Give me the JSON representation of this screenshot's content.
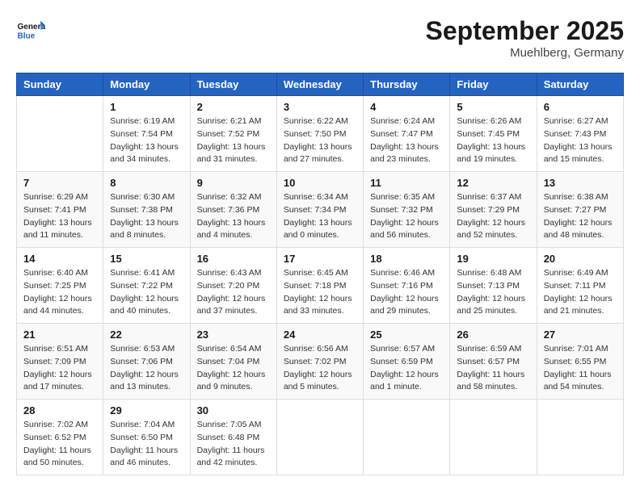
{
  "header": {
    "logo_text_general": "General",
    "logo_text_blue": "Blue",
    "month_title": "September 2025",
    "location": "Muehlberg, Germany"
  },
  "days_of_week": [
    "Sunday",
    "Monday",
    "Tuesday",
    "Wednesday",
    "Thursday",
    "Friday",
    "Saturday"
  ],
  "weeks": [
    [
      {
        "day": "",
        "sunrise": "",
        "sunset": "",
        "daylight": ""
      },
      {
        "day": "1",
        "sunrise": "Sunrise: 6:19 AM",
        "sunset": "Sunset: 7:54 PM",
        "daylight": "Daylight: 13 hours and 34 minutes."
      },
      {
        "day": "2",
        "sunrise": "Sunrise: 6:21 AM",
        "sunset": "Sunset: 7:52 PM",
        "daylight": "Daylight: 13 hours and 31 minutes."
      },
      {
        "day": "3",
        "sunrise": "Sunrise: 6:22 AM",
        "sunset": "Sunset: 7:50 PM",
        "daylight": "Daylight: 13 hours and 27 minutes."
      },
      {
        "day": "4",
        "sunrise": "Sunrise: 6:24 AM",
        "sunset": "Sunset: 7:47 PM",
        "daylight": "Daylight: 13 hours and 23 minutes."
      },
      {
        "day": "5",
        "sunrise": "Sunrise: 6:26 AM",
        "sunset": "Sunset: 7:45 PM",
        "daylight": "Daylight: 13 hours and 19 minutes."
      },
      {
        "day": "6",
        "sunrise": "Sunrise: 6:27 AM",
        "sunset": "Sunset: 7:43 PM",
        "daylight": "Daylight: 13 hours and 15 minutes."
      }
    ],
    [
      {
        "day": "7",
        "sunrise": "Sunrise: 6:29 AM",
        "sunset": "Sunset: 7:41 PM",
        "daylight": "Daylight: 13 hours and 11 minutes."
      },
      {
        "day": "8",
        "sunrise": "Sunrise: 6:30 AM",
        "sunset": "Sunset: 7:38 PM",
        "daylight": "Daylight: 13 hours and 8 minutes."
      },
      {
        "day": "9",
        "sunrise": "Sunrise: 6:32 AM",
        "sunset": "Sunset: 7:36 PM",
        "daylight": "Daylight: 13 hours and 4 minutes."
      },
      {
        "day": "10",
        "sunrise": "Sunrise: 6:34 AM",
        "sunset": "Sunset: 7:34 PM",
        "daylight": "Daylight: 13 hours and 0 minutes."
      },
      {
        "day": "11",
        "sunrise": "Sunrise: 6:35 AM",
        "sunset": "Sunset: 7:32 PM",
        "daylight": "Daylight: 12 hours and 56 minutes."
      },
      {
        "day": "12",
        "sunrise": "Sunrise: 6:37 AM",
        "sunset": "Sunset: 7:29 PM",
        "daylight": "Daylight: 12 hours and 52 minutes."
      },
      {
        "day": "13",
        "sunrise": "Sunrise: 6:38 AM",
        "sunset": "Sunset: 7:27 PM",
        "daylight": "Daylight: 12 hours and 48 minutes."
      }
    ],
    [
      {
        "day": "14",
        "sunrise": "Sunrise: 6:40 AM",
        "sunset": "Sunset: 7:25 PM",
        "daylight": "Daylight: 12 hours and 44 minutes."
      },
      {
        "day": "15",
        "sunrise": "Sunrise: 6:41 AM",
        "sunset": "Sunset: 7:22 PM",
        "daylight": "Daylight: 12 hours and 40 minutes."
      },
      {
        "day": "16",
        "sunrise": "Sunrise: 6:43 AM",
        "sunset": "Sunset: 7:20 PM",
        "daylight": "Daylight: 12 hours and 37 minutes."
      },
      {
        "day": "17",
        "sunrise": "Sunrise: 6:45 AM",
        "sunset": "Sunset: 7:18 PM",
        "daylight": "Daylight: 12 hours and 33 minutes."
      },
      {
        "day": "18",
        "sunrise": "Sunrise: 6:46 AM",
        "sunset": "Sunset: 7:16 PM",
        "daylight": "Daylight: 12 hours and 29 minutes."
      },
      {
        "day": "19",
        "sunrise": "Sunrise: 6:48 AM",
        "sunset": "Sunset: 7:13 PM",
        "daylight": "Daylight: 12 hours and 25 minutes."
      },
      {
        "day": "20",
        "sunrise": "Sunrise: 6:49 AM",
        "sunset": "Sunset: 7:11 PM",
        "daylight": "Daylight: 12 hours and 21 minutes."
      }
    ],
    [
      {
        "day": "21",
        "sunrise": "Sunrise: 6:51 AM",
        "sunset": "Sunset: 7:09 PM",
        "daylight": "Daylight: 12 hours and 17 minutes."
      },
      {
        "day": "22",
        "sunrise": "Sunrise: 6:53 AM",
        "sunset": "Sunset: 7:06 PM",
        "daylight": "Daylight: 12 hours and 13 minutes."
      },
      {
        "day": "23",
        "sunrise": "Sunrise: 6:54 AM",
        "sunset": "Sunset: 7:04 PM",
        "daylight": "Daylight: 12 hours and 9 minutes."
      },
      {
        "day": "24",
        "sunrise": "Sunrise: 6:56 AM",
        "sunset": "Sunset: 7:02 PM",
        "daylight": "Daylight: 12 hours and 5 minutes."
      },
      {
        "day": "25",
        "sunrise": "Sunrise: 6:57 AM",
        "sunset": "Sunset: 6:59 PM",
        "daylight": "Daylight: 12 hours and 1 minute."
      },
      {
        "day": "26",
        "sunrise": "Sunrise: 6:59 AM",
        "sunset": "Sunset: 6:57 PM",
        "daylight": "Daylight: 11 hours and 58 minutes."
      },
      {
        "day": "27",
        "sunrise": "Sunrise: 7:01 AM",
        "sunset": "Sunset: 6:55 PM",
        "daylight": "Daylight: 11 hours and 54 minutes."
      }
    ],
    [
      {
        "day": "28",
        "sunrise": "Sunrise: 7:02 AM",
        "sunset": "Sunset: 6:52 PM",
        "daylight": "Daylight: 11 hours and 50 minutes."
      },
      {
        "day": "29",
        "sunrise": "Sunrise: 7:04 AM",
        "sunset": "Sunset: 6:50 PM",
        "daylight": "Daylight: 11 hours and 46 minutes."
      },
      {
        "day": "30",
        "sunrise": "Sunrise: 7:05 AM",
        "sunset": "Sunset: 6:48 PM",
        "daylight": "Daylight: 11 hours and 42 minutes."
      },
      {
        "day": "",
        "sunrise": "",
        "sunset": "",
        "daylight": ""
      },
      {
        "day": "",
        "sunrise": "",
        "sunset": "",
        "daylight": ""
      },
      {
        "day": "",
        "sunrise": "",
        "sunset": "",
        "daylight": ""
      },
      {
        "day": "",
        "sunrise": "",
        "sunset": "",
        "daylight": ""
      }
    ]
  ]
}
